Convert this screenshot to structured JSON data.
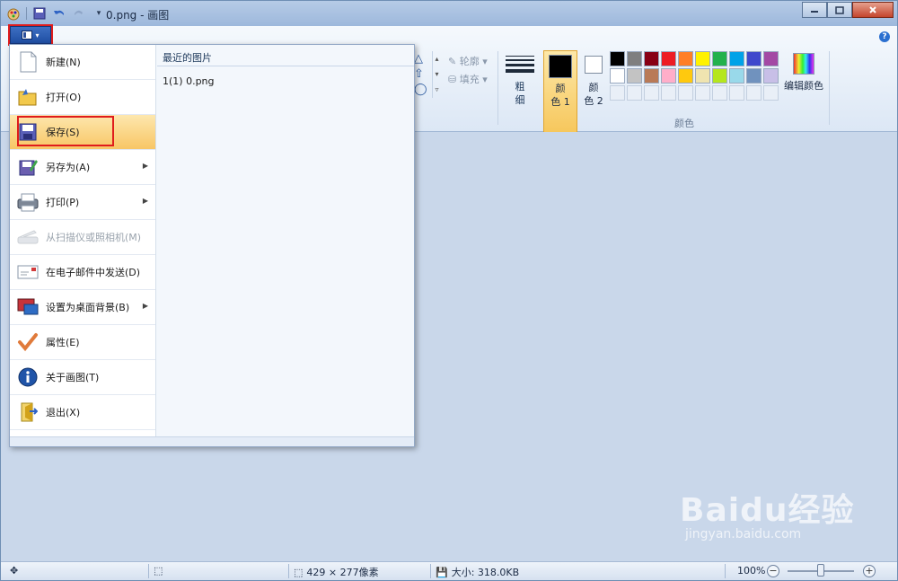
{
  "window": {
    "title": "0.png - 画图"
  },
  "filemenu": {
    "items": [
      {
        "label": "新建(N)",
        "icon": "new-file-icon",
        "submenu": false,
        "disabled": false
      },
      {
        "label": "打开(O)",
        "icon": "open-folder-icon",
        "submenu": false,
        "disabled": false
      },
      {
        "label": "保存(S)",
        "icon": "save-disk-icon",
        "submenu": false,
        "disabled": false,
        "selected": true
      },
      {
        "label": "另存为(A)",
        "icon": "save-as-icon",
        "submenu": true,
        "disabled": false
      },
      {
        "label": "打印(P)",
        "icon": "printer-icon",
        "submenu": true,
        "disabled": false
      },
      {
        "label": "从扫描仪或照相机(M)",
        "icon": "scanner-icon",
        "submenu": false,
        "disabled": true
      },
      {
        "label": "在电子邮件中发送(D)",
        "icon": "email-icon",
        "submenu": false,
        "disabled": false
      },
      {
        "label": "设置为桌面背景(B)",
        "icon": "desktop-icon",
        "submenu": true,
        "disabled": false
      },
      {
        "label": "属性(E)",
        "icon": "checkmark-icon",
        "submenu": false,
        "disabled": false
      },
      {
        "label": "关于画图(T)",
        "icon": "info-icon",
        "submenu": false,
        "disabled": false
      },
      {
        "label": "退出(X)",
        "icon": "exit-icon",
        "submenu": false,
        "disabled": false
      }
    ],
    "recent_title": "最近的图片",
    "recent_items": [
      {
        "label": "1(1)  0.png"
      }
    ]
  },
  "ribbon": {
    "outline_label": "轮廓",
    "fill_label": "填充",
    "thickness_label": "粗\n细",
    "color1_label": "颜\n色 1",
    "color2_label": "颜\n色 2",
    "edit_colors_label": "编辑颜色",
    "colors_group_label": "颜色",
    "color1": "#000000",
    "color2": "#ffffff",
    "palette_row1": [
      "#000000",
      "#7f7f7f",
      "#880015",
      "#ed1c24",
      "#ff7f27",
      "#fff200",
      "#22b14c",
      "#00a2e8",
      "#3f48cc",
      "#a349a4"
    ],
    "palette_row2": [
      "#ffffff",
      "#c3c3c3",
      "#b97a57",
      "#ffaec9",
      "#ffc90e",
      "#efe4b0",
      "#b5e61d",
      "#99d9ea",
      "#7092be",
      "#c8bfe7"
    ]
  },
  "statusbar": {
    "dimensions": "429 × 277像素",
    "size": "大小: 318.0KB",
    "zoom": "100%"
  },
  "watermark": {
    "brand": "Baidu经验",
    "url": "jingyan.baidu.com"
  }
}
